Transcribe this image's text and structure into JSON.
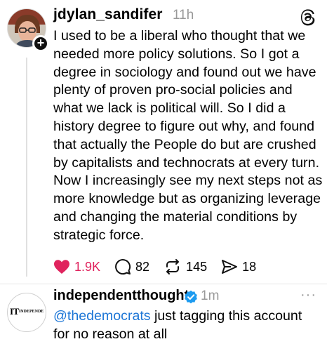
{
  "post": {
    "username": "jdylan_sandifer",
    "time": "11h",
    "text": "I used to be a liberal who thought that we needed more policy solutions. So I got a degree in sociology and found out we have plenty of proven pro-social policies and what we lack is political will. So I did a history degree to figure out why, and found that actually the People do but are crushed by capitalists and technocrats at every turn. Now I increasingly see my next steps not as more knowledge but as organizing leverage and changing the material conditions by strategic force.",
    "likes": "1.9K",
    "replies": "82",
    "reposts": "145",
    "shares": "18",
    "follow_badge": "+"
  },
  "reply": {
    "username": "independentthought",
    "time": "1m",
    "mention": "@thedemocrats",
    "text": " just tagging this account for no reason at all",
    "avatar_logo": "IT",
    "avatar_logo_sub": "INDEPENDE",
    "more": "···"
  },
  "colors": {
    "like": "#e0245e",
    "mention": "#1d76d6",
    "verified": "#1d9bf0",
    "muted": "#999999"
  }
}
